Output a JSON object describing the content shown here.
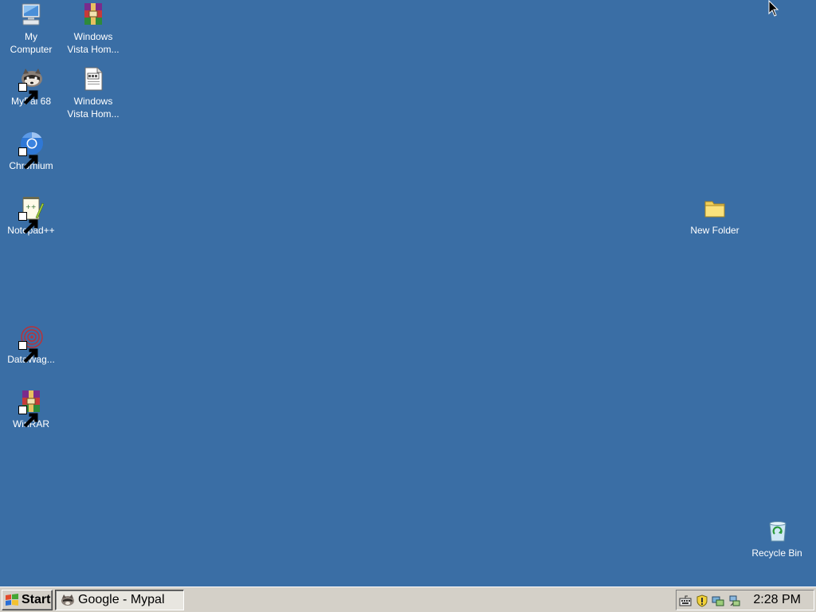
{
  "desktop": {
    "background_color": "#3a6ea5",
    "icons": [
      {
        "name": "my-computer",
        "line1": "My",
        "line2": "Computer",
        "icon": "computer-icon",
        "shortcut": false
      },
      {
        "name": "windows-vista-archive",
        "line1": "Windows",
        "line2": "Vista Hom...",
        "icon": "winrar-archive-icon",
        "shortcut": false
      },
      {
        "name": "mypal",
        "line1": "MyPal 68",
        "line2": "",
        "icon": "mypal-raccoon-icon",
        "shortcut": true
      },
      {
        "name": "windows-vista-doc",
        "line1": "Windows",
        "line2": "Vista Hom...",
        "icon": "document-icon",
        "shortcut": false
      },
      {
        "name": "chromium",
        "line1": "Chromium",
        "line2": "",
        "icon": "chromium-icon",
        "shortcut": true
      },
      {
        "name": "notepadpp",
        "line1": "Notepad++",
        "line2": "",
        "icon": "notepadpp-icon",
        "shortcut": true
      },
      {
        "name": "new-folder",
        "line1": "New Folder",
        "line2": "",
        "icon": "folder-icon",
        "shortcut": false
      },
      {
        "name": "datawag",
        "line1": "DataWag...",
        "line2": "",
        "icon": "datawag-icon",
        "shortcut": true
      },
      {
        "name": "winrar",
        "line1": "WinRAR",
        "line2": "",
        "icon": "winrar-icon",
        "shortcut": true
      },
      {
        "name": "recycle-bin",
        "line1": "Recycle Bin",
        "line2": "",
        "icon": "recycle-bin-icon",
        "shortcut": false
      }
    ]
  },
  "taskbar": {
    "start_label": "Start",
    "tasks": [
      {
        "label": "Google - Mypal",
        "icon": "mypal-raccoon-icon"
      }
    ],
    "tray_icons": [
      "keyboard-icon",
      "security-shield-icon",
      "network-icon",
      "network-connection-icon"
    ],
    "clock": "2:28 PM"
  }
}
